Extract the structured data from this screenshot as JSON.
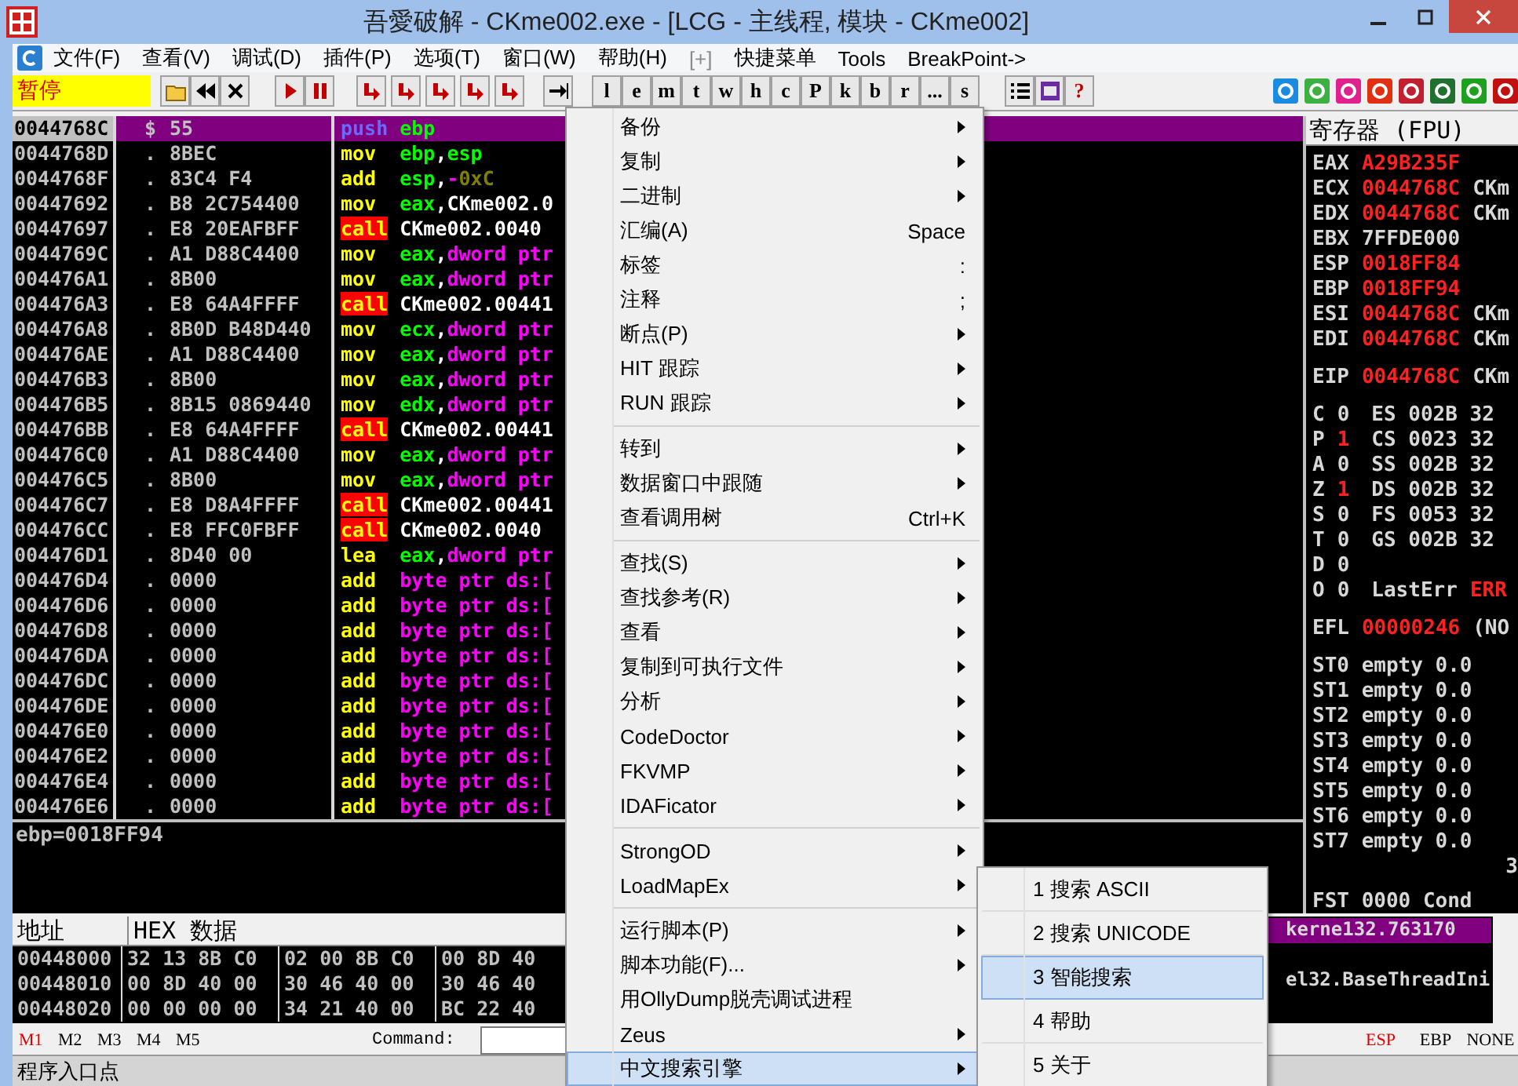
{
  "window": {
    "title": "吾愛破解 - CKme002.exe - [LCG -  主线程, 模块 - CKme002]"
  },
  "menu_bar": [
    {
      "label": "文件(F)",
      "disabled": false
    },
    {
      "label": "查看(V)",
      "disabled": false
    },
    {
      "label": "调试(D)",
      "disabled": false
    },
    {
      "label": "插件(P)",
      "disabled": false
    },
    {
      "label": "选项(T)",
      "disabled": false
    },
    {
      "label": "窗口(W)",
      "disabled": false
    },
    {
      "label": "帮助(H)",
      "disabled": false
    },
    {
      "label": "[+]",
      "disabled": true
    },
    {
      "label": "快捷菜单",
      "disabled": false
    },
    {
      "label": "Tools",
      "disabled": false
    },
    {
      "label": "BreakPoint->",
      "disabled": false
    }
  ],
  "status_label": "暂停",
  "letter_buttons": [
    "l",
    "e",
    "m",
    "t",
    "w",
    "h",
    "c",
    "P",
    "k",
    "b",
    "r",
    "...",
    "s"
  ],
  "help_button": "?",
  "disasm": {
    "rows": [
      {
        "address": "0044768C",
        "mark": "$",
        "hex": "55",
        "mnemonic": "push",
        "kind": "push",
        "selected": true,
        "operands": [
          {
            "text": "ebp",
            "kind": "reg"
          }
        ]
      },
      {
        "address": "0044768D",
        "mark": ".",
        "hex": "8BEC",
        "mnemonic": "mov",
        "kind": "plain",
        "selected": false,
        "operands": [
          {
            "text": "ebp",
            "kind": "reg"
          },
          {
            "text": ",",
            "kind": "punct"
          },
          {
            "text": "esp",
            "kind": "reg"
          }
        ]
      },
      {
        "address": "0044768F",
        "mark": ".",
        "hex": "83C4 F4",
        "mnemonic": "add",
        "kind": "plain",
        "selected": false,
        "operands": [
          {
            "text": "esp",
            "kind": "reg"
          },
          {
            "text": ",",
            "kind": "punct"
          },
          {
            "text": "-",
            "kind": "mem"
          },
          {
            "text": "0xC",
            "kind": "imm"
          }
        ]
      },
      {
        "address": "00447692",
        "mark": ".",
        "hex": "B8 2C754400",
        "mnemonic": "mov",
        "kind": "plain",
        "selected": false,
        "operands": [
          {
            "text": "eax",
            "kind": "reg"
          },
          {
            "text": ",",
            "kind": "punct"
          },
          {
            "text": "CKme002.0",
            "kind": "label"
          }
        ]
      },
      {
        "address": "00447697",
        "mark": ".",
        "hex": "E8 20EAFBFF",
        "mnemonic": "call",
        "kind": "call",
        "selected": false,
        "operands": [
          {
            "text": "CKme002.0040",
            "kind": "label"
          }
        ]
      },
      {
        "address": "0044769C",
        "mark": ".",
        "hex": "A1 D88C4400",
        "mnemonic": "mov",
        "kind": "plain",
        "selected": false,
        "operands": [
          {
            "text": "eax",
            "kind": "reg"
          },
          {
            "text": ",",
            "kind": "punct"
          },
          {
            "text": "dword ptr",
            "kind": "mem"
          }
        ]
      },
      {
        "address": "004476A1",
        "mark": ".",
        "hex": "8B00",
        "mnemonic": "mov",
        "kind": "plain",
        "selected": false,
        "operands": [
          {
            "text": "eax",
            "kind": "reg"
          },
          {
            "text": ",",
            "kind": "punct"
          },
          {
            "text": "dword ptr",
            "kind": "mem"
          }
        ]
      },
      {
        "address": "004476A3",
        "mark": ".",
        "hex": "E8 64A4FFFF",
        "mnemonic": "call",
        "kind": "call",
        "selected": false,
        "operands": [
          {
            "text": "CKme002.00441",
            "kind": "label"
          }
        ]
      },
      {
        "address": "004476A8",
        "mark": ".",
        "hex": "8B0D B48D440",
        "mnemonic": "mov",
        "kind": "plain",
        "selected": false,
        "operands": [
          {
            "text": "ecx",
            "kind": "reg"
          },
          {
            "text": ",",
            "kind": "punct"
          },
          {
            "text": "dword ptr",
            "kind": "mem"
          }
        ]
      },
      {
        "address": "004476AE",
        "mark": ".",
        "hex": "A1 D88C4400",
        "mnemonic": "mov",
        "kind": "plain",
        "selected": false,
        "operands": [
          {
            "text": "eax",
            "kind": "reg"
          },
          {
            "text": ",",
            "kind": "punct"
          },
          {
            "text": "dword ptr",
            "kind": "mem"
          }
        ]
      },
      {
        "address": "004476B3",
        "mark": ".",
        "hex": "8B00",
        "mnemonic": "mov",
        "kind": "plain",
        "selected": false,
        "operands": [
          {
            "text": "eax",
            "kind": "reg"
          },
          {
            "text": ",",
            "kind": "punct"
          },
          {
            "text": "dword ptr",
            "kind": "mem"
          }
        ]
      },
      {
        "address": "004476B5",
        "mark": ".",
        "hex": "8B15 0869440",
        "mnemonic": "mov",
        "kind": "plain",
        "selected": false,
        "operands": [
          {
            "text": "edx",
            "kind": "reg"
          },
          {
            "text": ",",
            "kind": "punct"
          },
          {
            "text": "dword ptr",
            "kind": "mem"
          }
        ]
      },
      {
        "address": "004476BB",
        "mark": ".",
        "hex": "E8 64A4FFFF",
        "mnemonic": "call",
        "kind": "call",
        "selected": false,
        "operands": [
          {
            "text": "CKme002.00441",
            "kind": "label"
          }
        ]
      },
      {
        "address": "004476C0",
        "mark": ".",
        "hex": "A1 D88C4400",
        "mnemonic": "mov",
        "kind": "plain",
        "selected": false,
        "operands": [
          {
            "text": "eax",
            "kind": "reg"
          },
          {
            "text": ",",
            "kind": "punct"
          },
          {
            "text": "dword ptr",
            "kind": "mem"
          }
        ]
      },
      {
        "address": "004476C5",
        "mark": ".",
        "hex": "8B00",
        "mnemonic": "mov",
        "kind": "plain",
        "selected": false,
        "operands": [
          {
            "text": "eax",
            "kind": "reg"
          },
          {
            "text": ",",
            "kind": "punct"
          },
          {
            "text": "dword ptr",
            "kind": "mem"
          }
        ]
      },
      {
        "address": "004476C7",
        "mark": ".",
        "hex": "E8 D8A4FFFF",
        "mnemonic": "call",
        "kind": "call",
        "selected": false,
        "operands": [
          {
            "text": "CKme002.00441",
            "kind": "label"
          }
        ]
      },
      {
        "address": "004476CC",
        "mark": ".",
        "hex": "E8 FFC0FBFF",
        "mnemonic": "call",
        "kind": "call",
        "selected": false,
        "operands": [
          {
            "text": "CKme002.0040",
            "kind": "label"
          }
        ]
      },
      {
        "address": "004476D1",
        "mark": ".",
        "hex": "8D40 00",
        "mnemonic": "lea",
        "kind": "plain",
        "selected": false,
        "operands": [
          {
            "text": "eax",
            "kind": "reg"
          },
          {
            "text": ",",
            "kind": "punct"
          },
          {
            "text": "dword ptr",
            "kind": "mem"
          }
        ]
      },
      {
        "address": "004476D4",
        "mark": ".",
        "hex": "0000",
        "mnemonic": "add",
        "kind": "plain",
        "selected": false,
        "operands": [
          {
            "text": "byte ptr ds:[",
            "kind": "mem"
          }
        ]
      },
      {
        "address": "004476D6",
        "mark": ".",
        "hex": "0000",
        "mnemonic": "add",
        "kind": "plain",
        "selected": false,
        "operands": [
          {
            "text": "byte ptr ds:[",
            "kind": "mem"
          }
        ]
      },
      {
        "address": "004476D8",
        "mark": ".",
        "hex": "0000",
        "mnemonic": "add",
        "kind": "plain",
        "selected": false,
        "operands": [
          {
            "text": "byte ptr ds:[",
            "kind": "mem"
          }
        ]
      },
      {
        "address": "004476DA",
        "mark": ".",
        "hex": "0000",
        "mnemonic": "add",
        "kind": "plain",
        "selected": false,
        "operands": [
          {
            "text": "byte ptr ds:[",
            "kind": "mem"
          }
        ]
      },
      {
        "address": "004476DC",
        "mark": ".",
        "hex": "0000",
        "mnemonic": "add",
        "kind": "plain",
        "selected": false,
        "operands": [
          {
            "text": "byte ptr ds:[",
            "kind": "mem"
          }
        ]
      },
      {
        "address": "004476DE",
        "mark": ".",
        "hex": "0000",
        "mnemonic": "add",
        "kind": "plain",
        "selected": false,
        "operands": [
          {
            "text": "byte ptr ds:[",
            "kind": "mem"
          }
        ]
      },
      {
        "address": "004476E0",
        "mark": ".",
        "hex": "0000",
        "mnemonic": "add",
        "kind": "plain",
        "selected": false,
        "operands": [
          {
            "text": "byte ptr ds:[",
            "kind": "mem"
          }
        ]
      },
      {
        "address": "004476E2",
        "mark": ".",
        "hex": "0000",
        "mnemonic": "add",
        "kind": "plain",
        "selected": false,
        "operands": [
          {
            "text": "byte ptr ds:[",
            "kind": "mem"
          }
        ]
      },
      {
        "address": "004476E4",
        "mark": ".",
        "hex": "0000",
        "mnemonic": "add",
        "kind": "plain",
        "selected": false,
        "operands": [
          {
            "text": "byte ptr ds:[",
            "kind": "mem"
          }
        ]
      },
      {
        "address": "004476E6",
        "mark": ".",
        "hex": "0000",
        "mnemonic": "add",
        "kind": "plain",
        "selected": false,
        "operands": [
          {
            "text": "byte ptr ds:[",
            "kind": "mem"
          }
        ]
      }
    ]
  },
  "registers": {
    "title": "寄存器 (FPU)",
    "general": [
      {
        "name": "EAX",
        "value": "A29B235F",
        "changed": true
      },
      {
        "name": "ECX",
        "value": "0044768C",
        "changed": true,
        "comment": "CKm"
      },
      {
        "name": "EDX",
        "value": "0044768C",
        "changed": true,
        "comment": "CKm"
      },
      {
        "name": "EBX",
        "value": "7FFDE000",
        "changed": false
      },
      {
        "name": "ESP",
        "value": "0018FF84",
        "changed": true
      },
      {
        "name": "EBP",
        "value": "0018FF94",
        "changed": true
      },
      {
        "name": "ESI",
        "value": "0044768C",
        "changed": true,
        "comment": "CKm"
      },
      {
        "name": "EDI",
        "value": "0044768C",
        "changed": true,
        "comment": "CKm"
      }
    ],
    "eip": {
      "name": "EIP",
      "value": "0044768C",
      "changed": true,
      "comment": "CKm"
    },
    "flags": [
      {
        "flag": "C",
        "value": "0",
        "changed": false,
        "segment": "ES",
        "selector": "002B",
        "bits": "32"
      },
      {
        "flag": "P",
        "value": "1",
        "changed": true,
        "segment": "CS",
        "selector": "0023",
        "bits": "32"
      },
      {
        "flag": "A",
        "value": "0",
        "changed": false,
        "segment": "SS",
        "selector": "002B",
        "bits": "32"
      },
      {
        "flag": "Z",
        "value": "1",
        "changed": true,
        "segment": "DS",
        "selector": "002B",
        "bits": "32"
      },
      {
        "flag": "S",
        "value": "0",
        "changed": false,
        "segment": "FS",
        "selector": "0053",
        "bits": "32"
      },
      {
        "flag": "T",
        "value": "0",
        "changed": false,
        "segment": "GS",
        "selector": "002B",
        "bits": "32"
      },
      {
        "flag": "D",
        "value": "0",
        "changed": false
      },
      {
        "flag": "O",
        "value": "0",
        "changed": false,
        "note_label": "LastErr",
        "note_value": "ERR"
      }
    ],
    "efl": {
      "name": "EFL",
      "value": "00000246",
      "changed": true,
      "note": "(NO"
    },
    "fpu": [
      {
        "name": "ST0",
        "tag": "empty",
        "value": "0.0"
      },
      {
        "name": "ST1",
        "tag": "empty",
        "value": "0.0"
      },
      {
        "name": "ST2",
        "tag": "empty",
        "value": "0.0"
      },
      {
        "name": "ST3",
        "tag": "empty",
        "value": "0.0"
      },
      {
        "name": "ST4",
        "tag": "empty",
        "value": "0.0"
      },
      {
        "name": "ST5",
        "tag": "empty",
        "value": "0.0"
      },
      {
        "name": "ST6",
        "tag": "empty",
        "value": "0.0"
      },
      {
        "name": "ST7",
        "tag": "empty",
        "value": "0.0"
      }
    ],
    "fpu_note": "3",
    "fst": {
      "name": "FST",
      "value": "0000",
      "cond_label": "Cond"
    }
  },
  "info": "ebp=0018FF94",
  "dump": {
    "columns": [
      "地址",
      "HEX 数据"
    ],
    "rows": [
      {
        "address": "00448000",
        "groups": [
          "32 13 8B C0",
          "02 00 8B C0",
          "00 8D 40"
        ]
      },
      {
        "address": "00448010",
        "groups": [
          "00 8D 40 00",
          "30 46 40 00",
          "30 46 40"
        ]
      },
      {
        "address": "00448020",
        "groups": [
          "00 00 00 00",
          "34 21 40 00",
          "BC 22 40"
        ]
      }
    ]
  },
  "stack": {
    "rows": [
      {
        "text": "kerne132.763170",
        "selected": true
      },
      {
        "text": "el32.BaseThreadIni",
        "selected": false
      }
    ]
  },
  "command_bar": {
    "memory_tabs": [
      {
        "label": "M1",
        "selected": true
      },
      {
        "label": "M2",
        "selected": false
      },
      {
        "label": "M3",
        "selected": false
      },
      {
        "label": "M4",
        "selected": false
      },
      {
        "label": "M5",
        "selected": false
      }
    ],
    "command_label": "Command:",
    "follow": [
      {
        "label": "ESP",
        "selected": true
      },
      {
        "label": "EBP",
        "selected": false
      },
      {
        "label": "NONE",
        "selected": false
      }
    ]
  },
  "status_bar": "程序入口点",
  "context_menu": {
    "items": [
      {
        "kind": "submenu",
        "label": "备份",
        "highlighted": false
      },
      {
        "kind": "submenu",
        "label": "复制",
        "highlighted": false
      },
      {
        "kind": "submenu",
        "label": "二进制",
        "highlighted": false
      },
      {
        "kind": "shortcut",
        "label": "汇编(A)",
        "shortcut": "Space",
        "highlighted": false
      },
      {
        "kind": "shortcut",
        "label": "标签",
        "shortcut": ":",
        "highlighted": false
      },
      {
        "kind": "shortcut",
        "label": "注释",
        "shortcut": ";",
        "highlighted": false
      },
      {
        "kind": "submenu",
        "label": "断点(P)",
        "highlighted": false
      },
      {
        "kind": "submenu",
        "label": "HIT 跟踪",
        "highlighted": false
      },
      {
        "kind": "submenu",
        "label": "RUN 跟踪",
        "highlighted": false
      },
      {
        "kind": "separator"
      },
      {
        "kind": "submenu",
        "label": "转到",
        "highlighted": false
      },
      {
        "kind": "submenu",
        "label": "数据窗口中跟随",
        "highlighted": false
      },
      {
        "kind": "shortcut",
        "label": "查看调用树",
        "shortcut": "Ctrl+K",
        "highlighted": false
      },
      {
        "kind": "separator"
      },
      {
        "kind": "submenu",
        "label": "查找(S)",
        "highlighted": false
      },
      {
        "kind": "submenu",
        "label": "查找参考(R)",
        "highlighted": false
      },
      {
        "kind": "submenu",
        "label": "查看",
        "highlighted": false
      },
      {
        "kind": "submenu",
        "label": "复制到可执行文件",
        "highlighted": false
      },
      {
        "kind": "submenu",
        "label": "分析",
        "highlighted": false
      },
      {
        "kind": "submenu",
        "label": "CodeDoctor",
        "highlighted": false
      },
      {
        "kind": "submenu",
        "label": "FKVMP",
        "highlighted": false
      },
      {
        "kind": "submenu",
        "label": "IDAFicator",
        "highlighted": false
      },
      {
        "kind": "separator"
      },
      {
        "kind": "submenu",
        "label": "StrongOD",
        "highlighted": false
      },
      {
        "kind": "submenu",
        "label": "LoadMapEx",
        "highlighted": false
      },
      {
        "kind": "separator"
      },
      {
        "kind": "submenu",
        "label": "运行脚本(P)",
        "highlighted": false
      },
      {
        "kind": "submenu",
        "label": "脚本功能(F)...",
        "highlighted": false
      },
      {
        "kind": "plain",
        "label": "用OllyDump脱壳调试进程",
        "highlighted": false
      },
      {
        "kind": "submenu",
        "label": "Zeus",
        "highlighted": false
      },
      {
        "kind": "submenu",
        "label": "中文搜索引擎",
        "highlighted": true
      }
    ]
  },
  "submenu": {
    "items": [
      {
        "label": "1 搜索 ASCII",
        "highlighted": false
      },
      {
        "label": "2 搜索 UNICODE",
        "highlighted": false
      },
      {
        "label": "3 智能搜索",
        "highlighted": true
      },
      {
        "label": "4 帮助",
        "highlighted": false
      },
      {
        "label": "5 关于",
        "highlighted": false
      }
    ]
  }
}
